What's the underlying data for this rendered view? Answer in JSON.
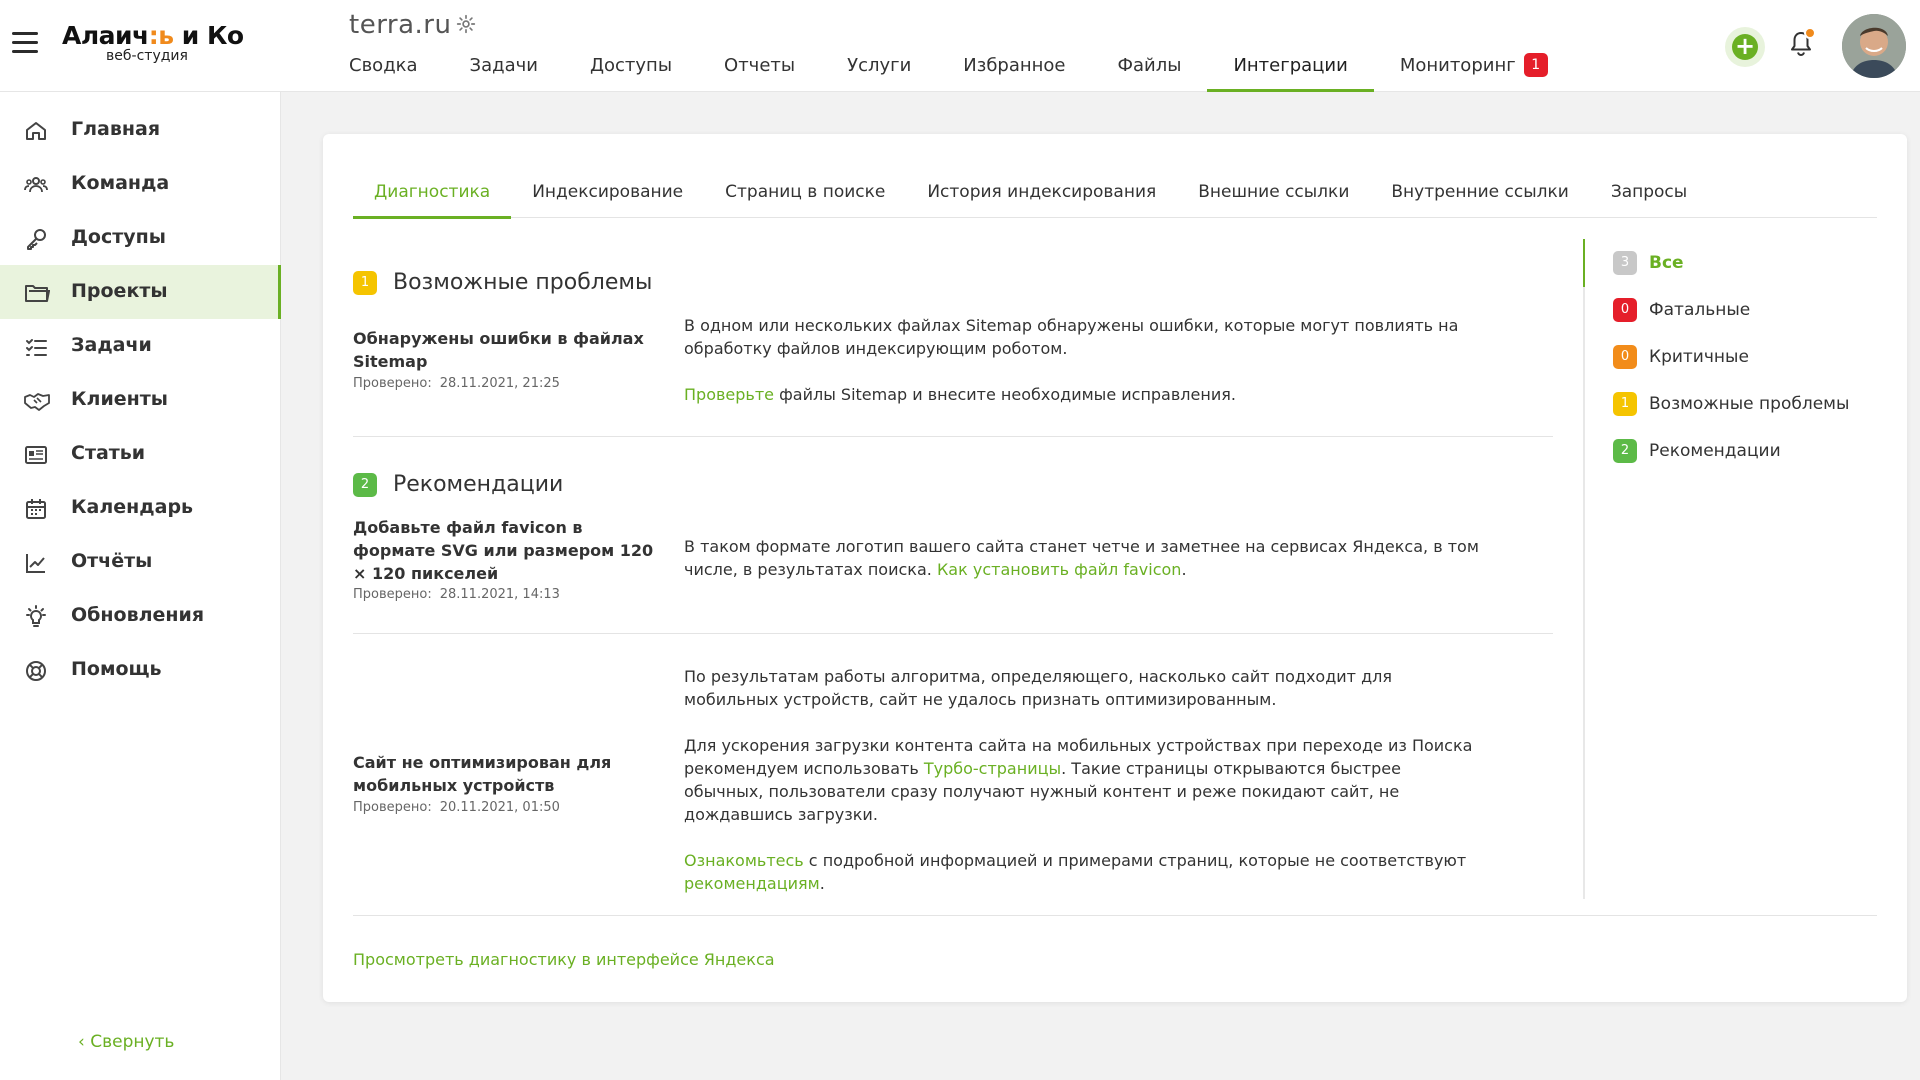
{
  "brand": {
    "name_part1": "Алаич",
    "name_accent": ":ь",
    "name_part2": " и Ко",
    "subtitle": "веб-студия"
  },
  "project": {
    "title": "terra.ru"
  },
  "top_tabs": [
    {
      "label": "Сводка"
    },
    {
      "label": "Задачи"
    },
    {
      "label": "Доступы"
    },
    {
      "label": "Отчеты"
    },
    {
      "label": "Услуги"
    },
    {
      "label": "Избранное"
    },
    {
      "label": "Файлы"
    },
    {
      "label": "Интеграции",
      "active": true
    },
    {
      "label": "Мониторинг",
      "badge": "1"
    }
  ],
  "sidebar": {
    "items": [
      {
        "label": "Главная",
        "icon": "home-icon"
      },
      {
        "label": "Команда",
        "icon": "team-icon"
      },
      {
        "label": "Доступы",
        "icon": "key-icon"
      },
      {
        "label": "Проекты",
        "icon": "folder-icon",
        "active": true
      },
      {
        "label": "Задачи",
        "icon": "tasks-icon"
      },
      {
        "label": "Клиенты",
        "icon": "handshake-icon"
      },
      {
        "label": "Статьи",
        "icon": "articles-icon"
      },
      {
        "label": "Календарь",
        "icon": "calendar-icon"
      },
      {
        "label": "Отчёты",
        "icon": "chart-icon"
      },
      {
        "label": "Обновления",
        "icon": "bulb-icon"
      },
      {
        "label": "Помощь",
        "icon": "lifebuoy-icon"
      }
    ],
    "collapse_label": "Свернуть"
  },
  "sub_tabs": [
    {
      "label": "Диагностика",
      "active": true
    },
    {
      "label": "Индексирование"
    },
    {
      "label": "Страниц в поиске"
    },
    {
      "label": "История индексирования"
    },
    {
      "label": "Внешние ссылки"
    },
    {
      "label": "Внутренние ссылки"
    },
    {
      "label": "Запросы"
    }
  ],
  "sections": {
    "possible": {
      "count": "1",
      "title": "Возможные проблемы",
      "issue": {
        "title": "Обнаружены ошибки в файлах Sitemap",
        "checked_label": "Проверено:",
        "checked_date": "28.11.2021, 21:25",
        "text1": "В одном или нескольких файлах Sitemap обнаружены ошибки, которые могут повлиять на обработку файлов индексирующим роботом.",
        "link": "Проверьте",
        "text2": " файлы Sitemap и внесите необходимые исправления."
      }
    },
    "recommendations": {
      "count": "2",
      "title": "Рекомендации",
      "issue1": {
        "title": "Добавьте файл favicon в формате SVG или размером 120 × 120 пикселей",
        "checked_label": "Проверено:",
        "checked_date": "28.11.2021, 14:13",
        "text": "В таком формате логотип вашего сайта станет четче и заметнее на сервисах Яндекса, в том числе, в результатах поиска. ",
        "link": "Как установить файл favicon",
        "text_end": "."
      },
      "issue2": {
        "title": "Сайт не оптимизирован для мобильных устройств",
        "checked_label": "Проверено:",
        "checked_date": "20.11.2021, 01:50",
        "p1": "По результатам работы алгоритма, определяющего, насколько сайт подходит для мобильных устройств, сайт не удалось признать оптимизированным.",
        "p2_a": "Для ускорения загрузки контента сайта на мобильных устройствах при переходе из Поиска рекомендуем использовать ",
        "p2_link": "Турбо-страницы",
        "p2_b": ". Такие страницы открываются быстрее обычных, пользователи сразу получают нужный контент и реже покидают сайт, не дождавшись загрузки.",
        "p3_link1": "Ознакомьтесь",
        "p3_a": " с подробной информацией и примерами страниц, которые не соответствуют ",
        "p3_link2": "рекомендациям",
        "p3_b": "."
      }
    }
  },
  "filters": [
    {
      "count": "3",
      "label": "Все",
      "color": "#c8c8c8",
      "active": true
    },
    {
      "count": "0",
      "label": "Фатальные",
      "color": "#e51e2a"
    },
    {
      "count": "0",
      "label": "Критичные",
      "color": "#f28c1a"
    },
    {
      "count": "1",
      "label": "Возможные проблемы",
      "color": "#f5c400"
    },
    {
      "count": "2",
      "label": "Рекомендации",
      "color": "#5cba47"
    }
  ],
  "footer_link": "Просмотреть диагностику в интерфейсе Яндекса",
  "colors": {
    "accent": "#6ab023",
    "danger": "#e51e2a",
    "warning": "#f28c1a",
    "notice": "#f5c400",
    "success": "#5cba47"
  }
}
